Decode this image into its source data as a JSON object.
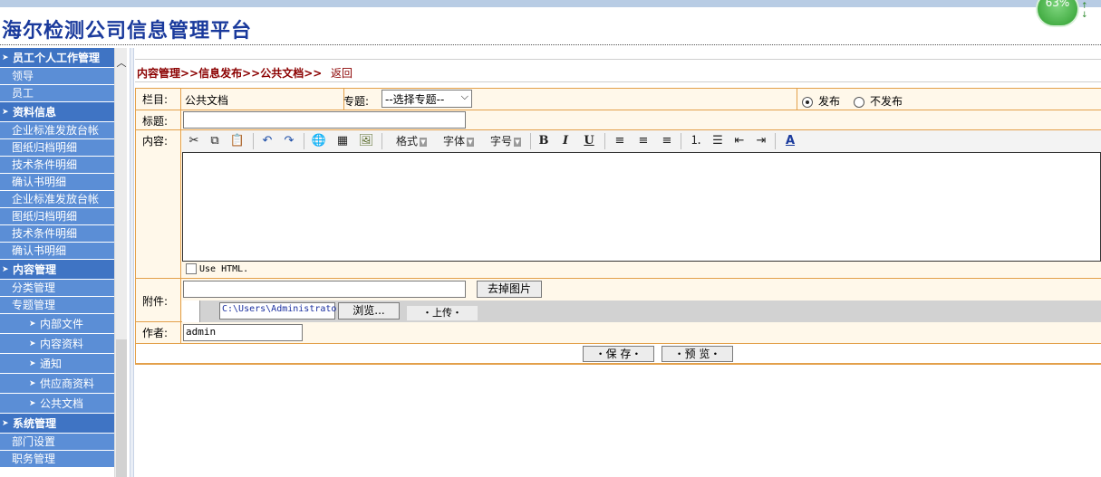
{
  "app": {
    "title": "海尔检测公司信息管理平台",
    "badge": "63%"
  },
  "sidebar": {
    "groups": [
      {
        "label": "员工个人工作管理",
        "items": [
          "领导",
          "员工"
        ]
      },
      {
        "label": "资料信息",
        "items": [
          "企业标准发放台帐",
          "图纸归档明细",
          "技术条件明细",
          "确认书明细",
          "企业标准发放台帐",
          "图纸归档明细",
          "技术条件明细",
          "确认书明细"
        ]
      },
      {
        "label": "内容管理",
        "items": [
          "分类管理",
          "专题管理"
        ],
        "subitems": [
          "内部文件",
          "内容资料",
          "通知",
          "供应商资料",
          "公共文档"
        ]
      },
      {
        "label": "系统管理",
        "items": [
          "部门设置",
          "职务管理"
        ]
      }
    ]
  },
  "breadcrumb": {
    "path": "内容管理>>信息发布>>公共文档>>",
    "back": "返回"
  },
  "form": {
    "column_label": "栏目:",
    "column_value": "公共文档",
    "topic_label": "专题:",
    "topic_select": "--选择专题--",
    "publish_on": "发布",
    "publish_off": "不发布",
    "title_label": "标题:",
    "content_label": "内容:",
    "toolbar": {
      "format": "格式",
      "font": "字体",
      "size": "字号"
    },
    "use_html": "Use HTML.",
    "attachment_label": "附件:",
    "remove_image": "去掉图片",
    "file_path": "C:\\Users\\Administrato",
    "browse": "浏览...",
    "upload": "・上传・",
    "author_label": "作者:",
    "author_value": "admin",
    "save": "・保 存・",
    "preview": "・预 览・"
  }
}
